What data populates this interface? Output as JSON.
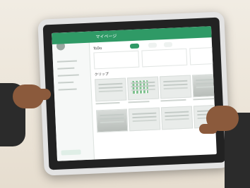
{
  "screen": {
    "app_title": "マイページ",
    "brand": "",
    "user": "",
    "status": "",
    "todo": "ToDo",
    "clip": "クリップ"
  },
  "colors": {
    "accent": "#2f9a66",
    "wall": "#efe8dc",
    "skin": "#8b5a3c",
    "sleeve": "#2b2b2b"
  }
}
